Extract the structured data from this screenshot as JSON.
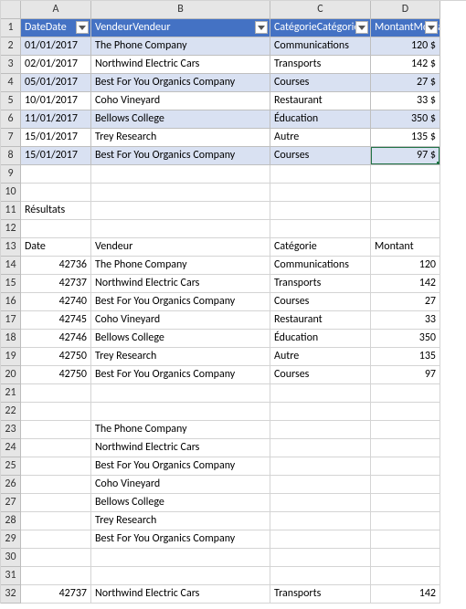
{
  "columns": [
    "A",
    "B",
    "C",
    "D"
  ],
  "header_row": {
    "date": "Date",
    "vendeur": "Vendeur",
    "categorie": "Catégorie",
    "montant": "Montant"
  },
  "table_rows": [
    {
      "date": "01/01/2017",
      "vendeur": "The Phone Company",
      "categorie": "Communications",
      "montant": "120 $"
    },
    {
      "date": "02/01/2017",
      "vendeur": "Northwind Electric Cars",
      "categorie": "Transports",
      "montant": "142 $"
    },
    {
      "date": "05/01/2017",
      "vendeur": "Best For You Organics Company",
      "categorie": "Courses",
      "montant": "27 $"
    },
    {
      "date": "10/01/2017",
      "vendeur": "Coho Vineyard",
      "categorie": "Restaurant",
      "montant": "33 $"
    },
    {
      "date": "11/01/2017",
      "vendeur": "Bellows College",
      "categorie": "Éducation",
      "montant": "350 $"
    },
    {
      "date": "15/01/2017",
      "vendeur": "Trey Research",
      "categorie": "Autre",
      "montant": "135 $"
    },
    {
      "date": "15/01/2017",
      "vendeur": "Best For You Organics Company",
      "categorie": "Courses",
      "montant": "97 $"
    }
  ],
  "results_label": "Résultats",
  "results_header": {
    "date": "Date",
    "vendeur": "Vendeur",
    "categorie": "Catégorie",
    "montant": "Montant"
  },
  "results_rows": [
    {
      "date": "42736",
      "vendeur": "The Phone Company",
      "categorie": "Communications",
      "montant": "120"
    },
    {
      "date": "42737",
      "vendeur": "Northwind Electric Cars",
      "categorie": "Transports",
      "montant": "142"
    },
    {
      "date": "42740",
      "vendeur": "Best For You Organics Company",
      "categorie": "Courses",
      "montant": "27"
    },
    {
      "date": "42745",
      "vendeur": "Coho Vineyard",
      "categorie": "Restaurant",
      "montant": "33"
    },
    {
      "date": "42746",
      "vendeur": "Bellows College",
      "categorie": "Éducation",
      "montant": "350"
    },
    {
      "date": "42750",
      "vendeur": "Trey Research",
      "categorie": "Autre",
      "montant": "135"
    },
    {
      "date": "42750",
      "vendeur": "Best For You Organics Company",
      "categorie": "Courses",
      "montant": "97"
    }
  ],
  "vendor_list": [
    "The Phone Company",
    "Northwind Electric Cars",
    "Best For You Organics Company",
    "Coho Vineyard",
    "Bellows College",
    "Trey Research",
    "Best For You Organics Company"
  ],
  "single_row": {
    "date": "42737",
    "vendeur": "Northwind Electric Cars",
    "categorie": "Transports",
    "montant": "142"
  },
  "row_numbers": [
    "1",
    "2",
    "3",
    "4",
    "5",
    "6",
    "7",
    "8",
    "9",
    "10",
    "11",
    "12",
    "13",
    "14",
    "15",
    "16",
    "17",
    "18",
    "19",
    "20",
    "21",
    "22",
    "23",
    "24",
    "25",
    "26",
    "27",
    "28",
    "29",
    "30",
    "31",
    "32"
  ]
}
